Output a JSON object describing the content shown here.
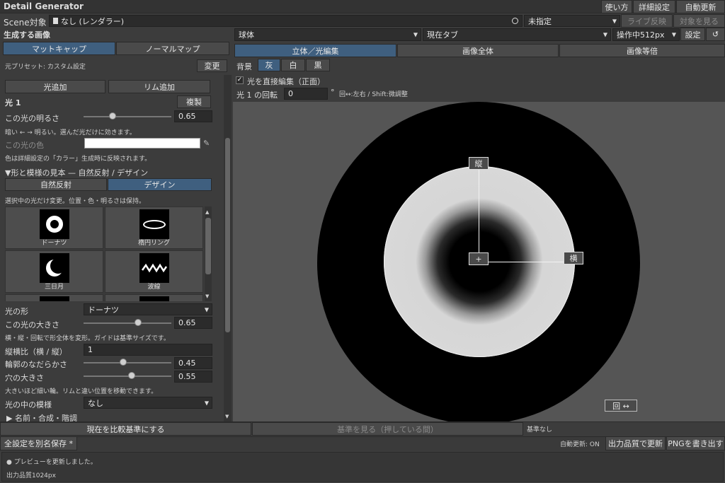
{
  "app": {
    "title": "Detail Generator",
    "menu": [
      "使い方",
      "詳細設定",
      "自動更新"
    ]
  },
  "scene": {
    "label": "Scene対象",
    "value": "なし (レンダラー)",
    "target": "未指定",
    "live": "ライブ反映",
    "view_target": "対象を見る"
  },
  "left": {
    "section_title": "生成する画像",
    "tabs": [
      "マットキャップ",
      "ノーマルマップ"
    ],
    "preset_label": "元プリセット: カスタム設定",
    "change": "変更",
    "add_light": "光追加",
    "add_rim": "リム追加",
    "light_title": "光 1",
    "duplicate": "複製",
    "brightness_label": "この光の明るさ",
    "brightness_value": "0.65",
    "brightness": 0.33,
    "brightness_help": "暗い ← → 明るい。選んだ光だけに効きます。",
    "color_label": "この光の色",
    "color_help": "色は詳細設定の「カラー」生成時に反映されます。",
    "pattern_section": "▼形と模様の見本 — 自然反射 / デザイン",
    "pattern_tabs": [
      "自然反射",
      "デザイン"
    ],
    "pattern_help": "選択中の光だけ変更。位置・色・明るさは保持。",
    "samples": [
      "ドーナツ",
      "楕円リング",
      "三日月",
      "波線"
    ],
    "shape_label": "光の形",
    "shape_value": "ドーナツ",
    "size_label": "この光の大きさ",
    "size_value": "0.65",
    "size": 0.62,
    "size_help": "横・縦・回転で形全体を変形。ガイドは基準サイズです。",
    "aspect_label": "縦横比（横 / 縦）",
    "aspect_value": "1",
    "soft_label": "輪郭のなだらかさ",
    "soft_value": "0.45",
    "soft": 0.45,
    "hole_label": "穴の大きさ",
    "hole_value": "0.55",
    "hole": 0.55,
    "hole_help": "大きいほど細い輪。リムと違い位置を移動できます。",
    "inner_pattern_label": "光の中の模様",
    "inner_pattern_value": "なし",
    "name_section": "▶ 名前・合成・階調"
  },
  "right": {
    "shape_select": "球体",
    "tab_select": "現在タブ",
    "op_select": "操作中512px",
    "settings": "設定",
    "refresh_icon": "↺",
    "view_tabs": [
      "立体／光編集",
      "画像全体",
      "画像等倍"
    ],
    "bg_label": "背景",
    "bg_options": [
      "灰",
      "白",
      "黒"
    ],
    "direct_edit": "光を直接編集（正面）",
    "rotate_label": "光 1 の回転",
    "rotate_value": "0",
    "rotate_unit": "°",
    "rotate_help": "回↔:左右 / Shift:微調整",
    "handle_v": "縦",
    "handle_h": "横",
    "handle_center": "+",
    "rotate_btn": "回 ↔"
  },
  "bottom": {
    "set_compare": "現在を比較基準にする",
    "view_base": "基準を見る（押している間）",
    "base_none": "基準なし",
    "save_as": "全設定を別名保存 *",
    "auto_update": "自動更新: ON",
    "update_quality": "出力品質で更新",
    "write_png": "PNGを書き出す",
    "status": "● プレビューを更新しました。",
    "quality": "出力品質1024px"
  },
  "colors": {
    "accent": "#3f5f7f",
    "panel": "#3c3c3c",
    "field": "#2b2b2b"
  }
}
